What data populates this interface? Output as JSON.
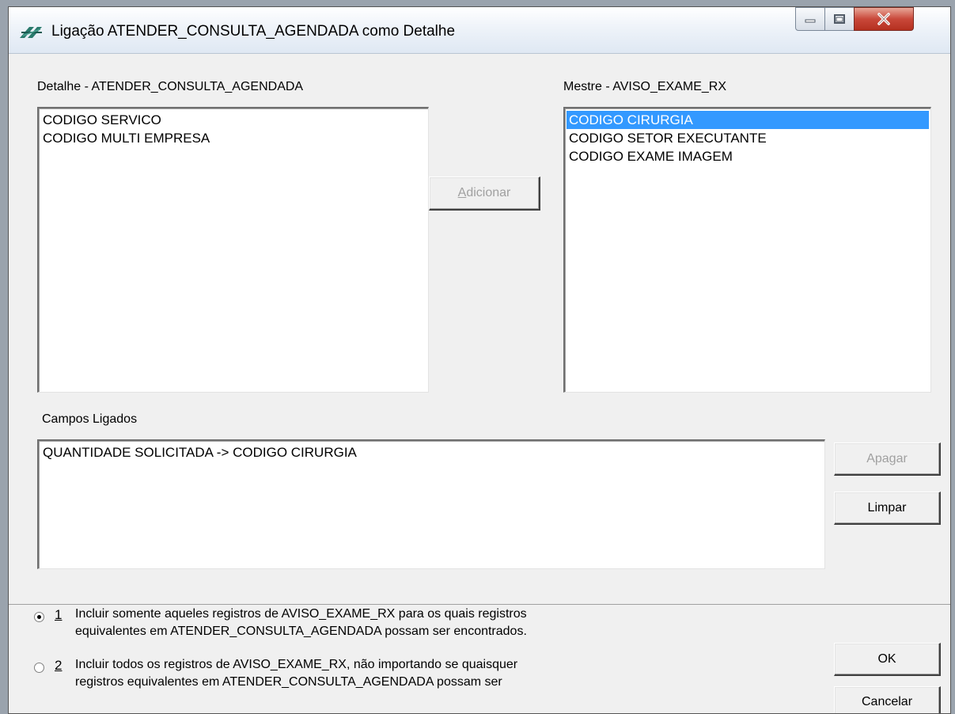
{
  "window": {
    "title": "Ligação ATENDER_CONSULTA_AGENDADA como Detalhe"
  },
  "detail": {
    "label": "Detalhe - ATENDER_CONSULTA_AGENDADA",
    "items": [
      "CODIGO SERVICO",
      "CODIGO MULTI EMPRESA"
    ]
  },
  "master": {
    "label": "Mestre - AVISO_EXAME_RX",
    "items": [
      "CODIGO CIRURGIA",
      "CODIGO SETOR EXECUTANTE",
      "CODIGO EXAME IMAGEM"
    ],
    "selected_index": 0
  },
  "buttons": {
    "add_mnemonic": "A",
    "add_rest": "dicionar",
    "delete_pre": "Apa",
    "delete_mnemonic": "g",
    "delete_post": "ar",
    "clear": "Limpar",
    "ok": "OK",
    "cancel": "Cancelar"
  },
  "linked": {
    "label": "Campos Ligados",
    "items": [
      "QUANTIDADE SOLICITADA -> CODIGO CIRURGIA"
    ]
  },
  "options": [
    {
      "number": "1",
      "line1": "Incluir somente aqueles registros de AVISO_EXAME_RX para os quais registros",
      "line2": "equivalentes em ATENDER_CONSULTA_AGENDADA possam ser encontrados.",
      "checked": true
    },
    {
      "number": "2",
      "line1": "Incluir todos os registros de AVISO_EXAME_RX, não importando se quaisquer",
      "line2": "registros equivalentes em ATENDER_CONSULTA_AGENDADA possam ser",
      "checked": false
    }
  ],
  "icons": {
    "app": "link-icon",
    "minimize": "minimize-icon",
    "maximize": "maximize-icon",
    "close": "close-icon"
  }
}
